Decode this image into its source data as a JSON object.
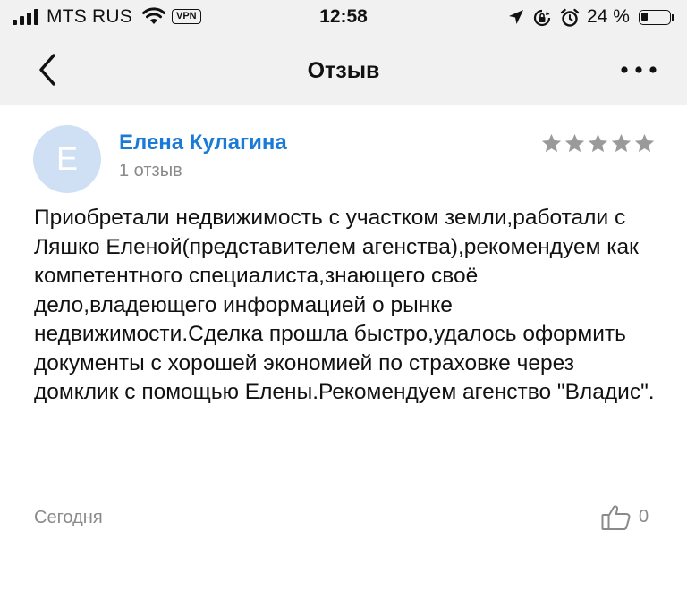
{
  "status_bar": {
    "carrier": "MTS RUS",
    "vpn": "VPN",
    "time": "12:58",
    "battery_percent": "24 %",
    "battery_level": 0.24,
    "icons": [
      "signal-icon",
      "wifi-icon",
      "location-arrow-icon",
      "rotation-lock-icon",
      "alarm-icon",
      "battery-icon"
    ]
  },
  "nav": {
    "title": "Отзыв",
    "icons": [
      "back-chevron-icon",
      "more-dots-icon"
    ]
  },
  "review": {
    "avatar_letter": "Е",
    "author": "Елена Кулагина",
    "reviews_count": "1 отзыв",
    "rating": 5,
    "text": "Приобретали недвижимость с участком земли,работали с Ляшко Еленой(представителем агенства),рекомендуем как компетентного специалиста,знающего своё дело,владеющего информацией о рынке недвижимости.Сделка прошла быстро,удалось оформить документы с хорошей экономией по страховке через домклик с помощью Елены.Рекомендуем агенство \"Владис\".",
    "date": "Сегодня",
    "likes": "0",
    "like_icon": "thumbs-up-icon"
  },
  "colors": {
    "accent": "#1a7ad7",
    "avatar_bg": "#cfe0f4",
    "top_bg": "#f1f1f1",
    "muted_text": "#8a8a8a",
    "star": "#9a9a9a"
  }
}
